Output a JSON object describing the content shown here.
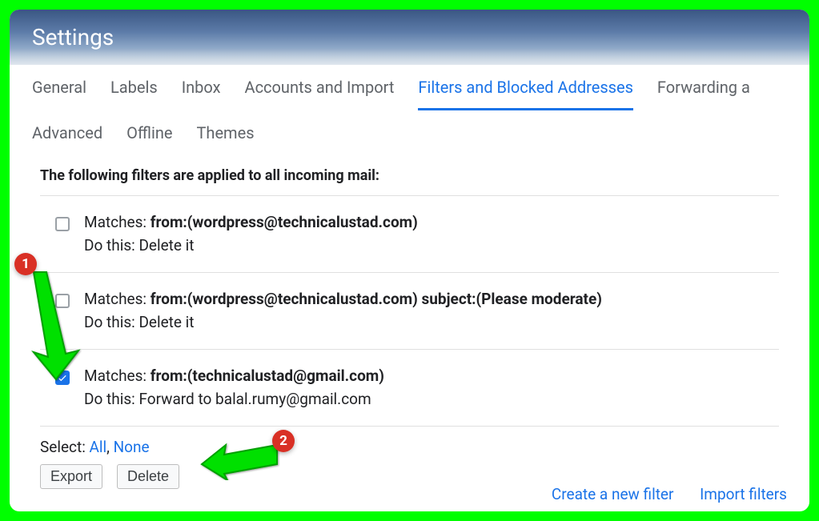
{
  "header": {
    "title": "Settings"
  },
  "tabs": {
    "general": "General",
    "labels": "Labels",
    "inbox": "Inbox",
    "accounts": "Accounts and Import",
    "filters": "Filters and Blocked Addresses",
    "forwarding": "Forwarding a",
    "advanced": "Advanced",
    "offline": "Offline",
    "themes": "Themes"
  },
  "intro": "The following filters are applied to all incoming mail:",
  "filters": [
    {
      "checked": false,
      "matches_label": "Matches: ",
      "matches_value": "from:(wordpress@technicalustad.com)",
      "action": "Do this: Delete it"
    },
    {
      "checked": false,
      "matches_label": "Matches: ",
      "matches_value": "from:(wordpress@technicalustad.com) subject:(Please moderate)",
      "action": "Do this: Delete it"
    },
    {
      "checked": true,
      "matches_label": "Matches: ",
      "matches_value": "from:(technicalustad@gmail.com)",
      "action": "Do this: Forward to balal.rumy@gmail.com"
    }
  ],
  "select": {
    "prefix": "Select: ",
    "all": "All",
    "separator": ", ",
    "none": "None"
  },
  "buttons": {
    "export": "Export",
    "delete": "Delete"
  },
  "bottom": {
    "create": "Create a new filter",
    "import": "Import filters"
  },
  "annotations": {
    "c1": "1",
    "c2": "2"
  }
}
